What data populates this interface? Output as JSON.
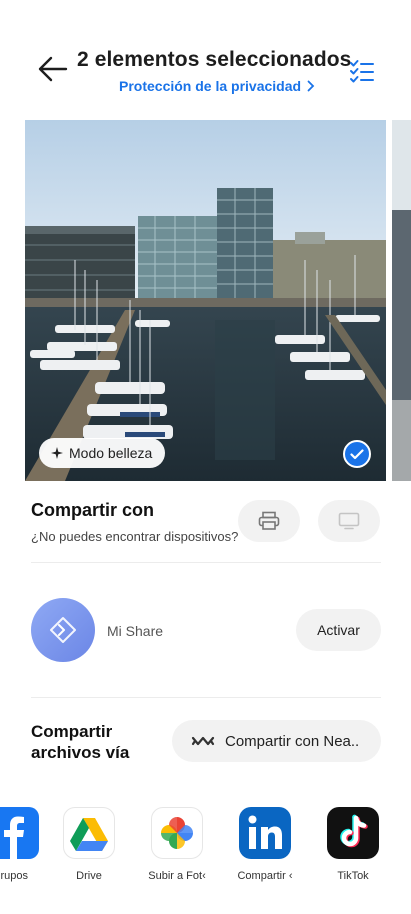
{
  "header": {
    "title": "2 elementos seleccionados",
    "privacy_link": "Protección de la privacidad",
    "back_icon": "arrow-left-icon",
    "select_icon": "checklist-icon"
  },
  "photo": {
    "beauty_label": "Modo belleza",
    "selected": true
  },
  "share_with": {
    "heading": "Compartir con",
    "subtext": "¿No puedes encontrar dispositivos?",
    "devices": [
      "printer-icon",
      "tv-icon"
    ]
  },
  "mishare": {
    "label": "Mi Share",
    "button": "Activar"
  },
  "share_via": {
    "heading_line1": "Compartir",
    "heading_line2": "archivos vía",
    "nearby_button": "Compartir con Nea.."
  },
  "apps": [
    {
      "label": "rupos",
      "icon": "facebook-icon"
    },
    {
      "label": "Drive",
      "icon": "google-drive-icon"
    },
    {
      "label": "Subir a Fot‹",
      "icon": "google-photos-icon"
    },
    {
      "label": "Compartir ‹",
      "icon": "linkedin-icon"
    },
    {
      "label": "TikTok",
      "icon": "tiktok-icon"
    }
  ],
  "colors": {
    "accent": "#1a73e8",
    "button_bg": "#f2f2f2"
  }
}
